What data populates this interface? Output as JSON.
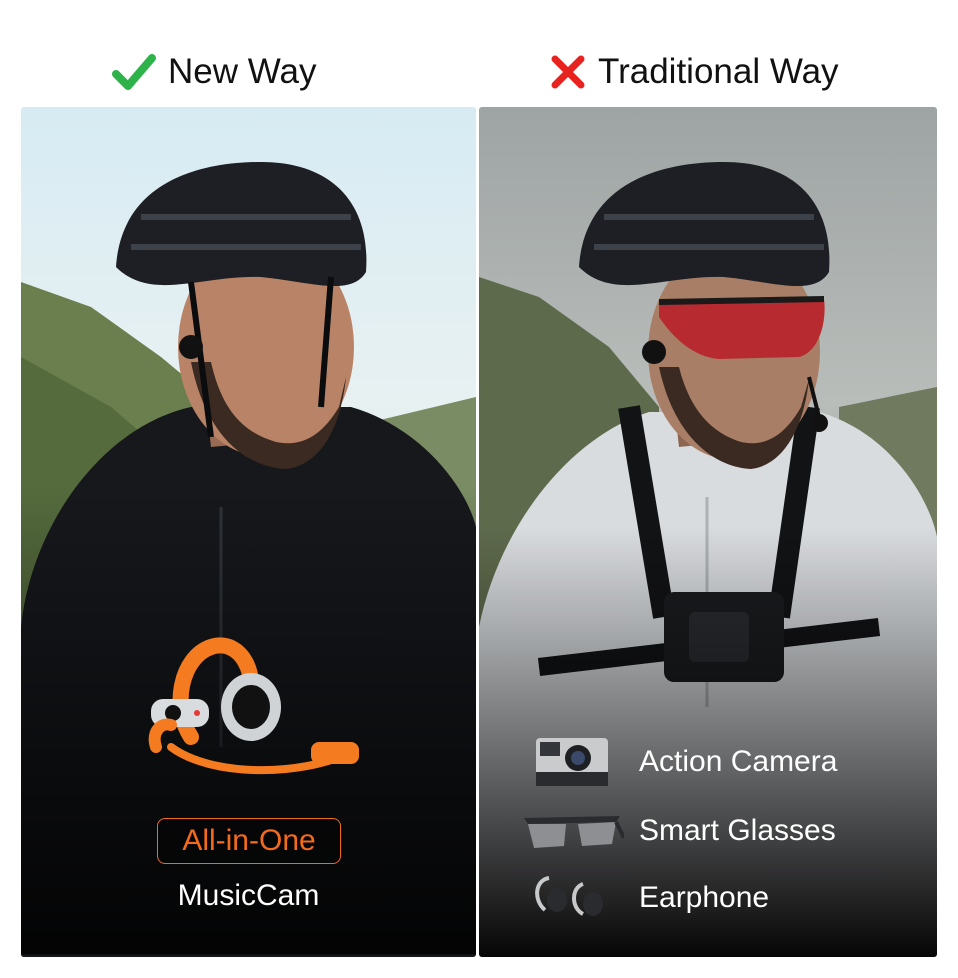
{
  "new_way": {
    "heading": "New Way",
    "heading_icon": "check-icon",
    "heading_icon_color": "#2db34a",
    "badge": "All-in-One",
    "badge_color": "#f36a1b",
    "product": "MusicCam"
  },
  "traditional_way": {
    "heading": "Traditional Way",
    "heading_icon": "cross-icon",
    "heading_icon_color": "#e8231f",
    "accessories": [
      {
        "label": "Action Camera",
        "icon": "action-camera-icon"
      },
      {
        "label": "Smart Glasses",
        "icon": "smart-glasses-icon"
      },
      {
        "label": "Earphone",
        "icon": "earphone-icon"
      }
    ]
  }
}
